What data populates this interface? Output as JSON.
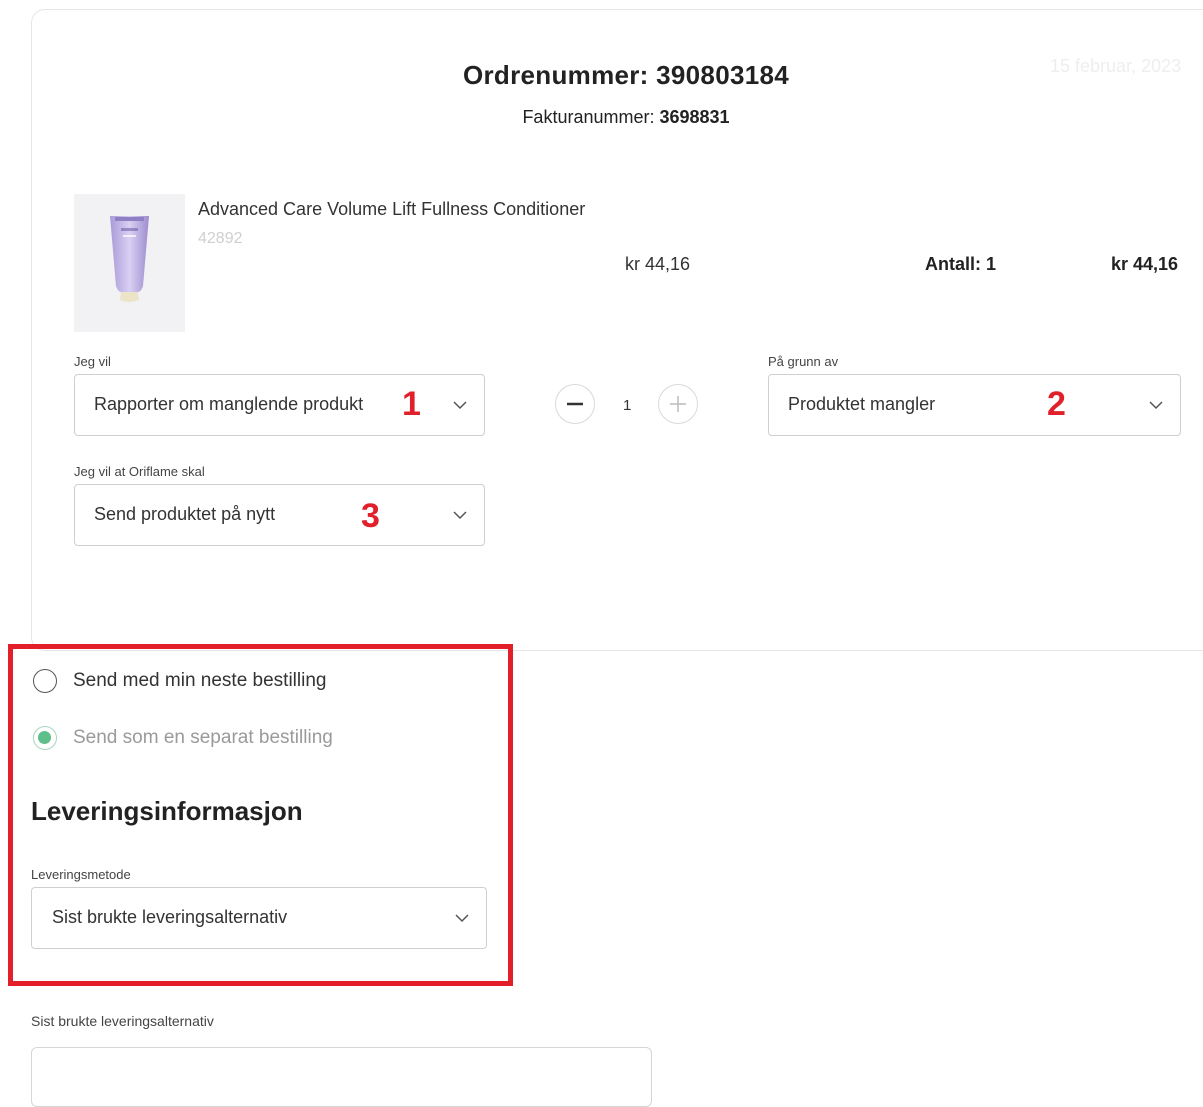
{
  "order": {
    "label": "Ordrenummer: ",
    "number": "390803184",
    "invoice_label": "Fakturanummer: ",
    "invoice_number": "3698831",
    "date": "15 februar, 2023"
  },
  "product": {
    "name": "Advanced Care Volume Lift Fullness Conditioner",
    "code": "42892",
    "unit_price": "kr 44,16",
    "quantity_text": "Antall: 1",
    "total": "kr 44,16"
  },
  "form": {
    "want_label": "Jeg vil",
    "want_value": "Rapporter om manglende produkt",
    "reason_label": "På grunn av",
    "reason_value": "Produktet mangler",
    "action_label": "Jeg vil at Oriflame skal",
    "action_value": "Send produktet på nytt",
    "stepper_value": "1"
  },
  "markers": {
    "m1": "1",
    "m2": "2",
    "m3": "3"
  },
  "shipping": {
    "option1": "Send med min neste bestilling",
    "option2": "Send som en separat bestilling",
    "selected_option": 2,
    "section_title": "Leveringsinformasjon",
    "method_label": "Leveringsmetode",
    "method_value": "Sist brukte leveringsalternativ",
    "bottom_label": "Sist brukte leveringsalternativ"
  },
  "colors": {
    "highlight": "#e3202a",
    "marker": "#e0202a",
    "radio_selected": "#5fbf8a"
  }
}
